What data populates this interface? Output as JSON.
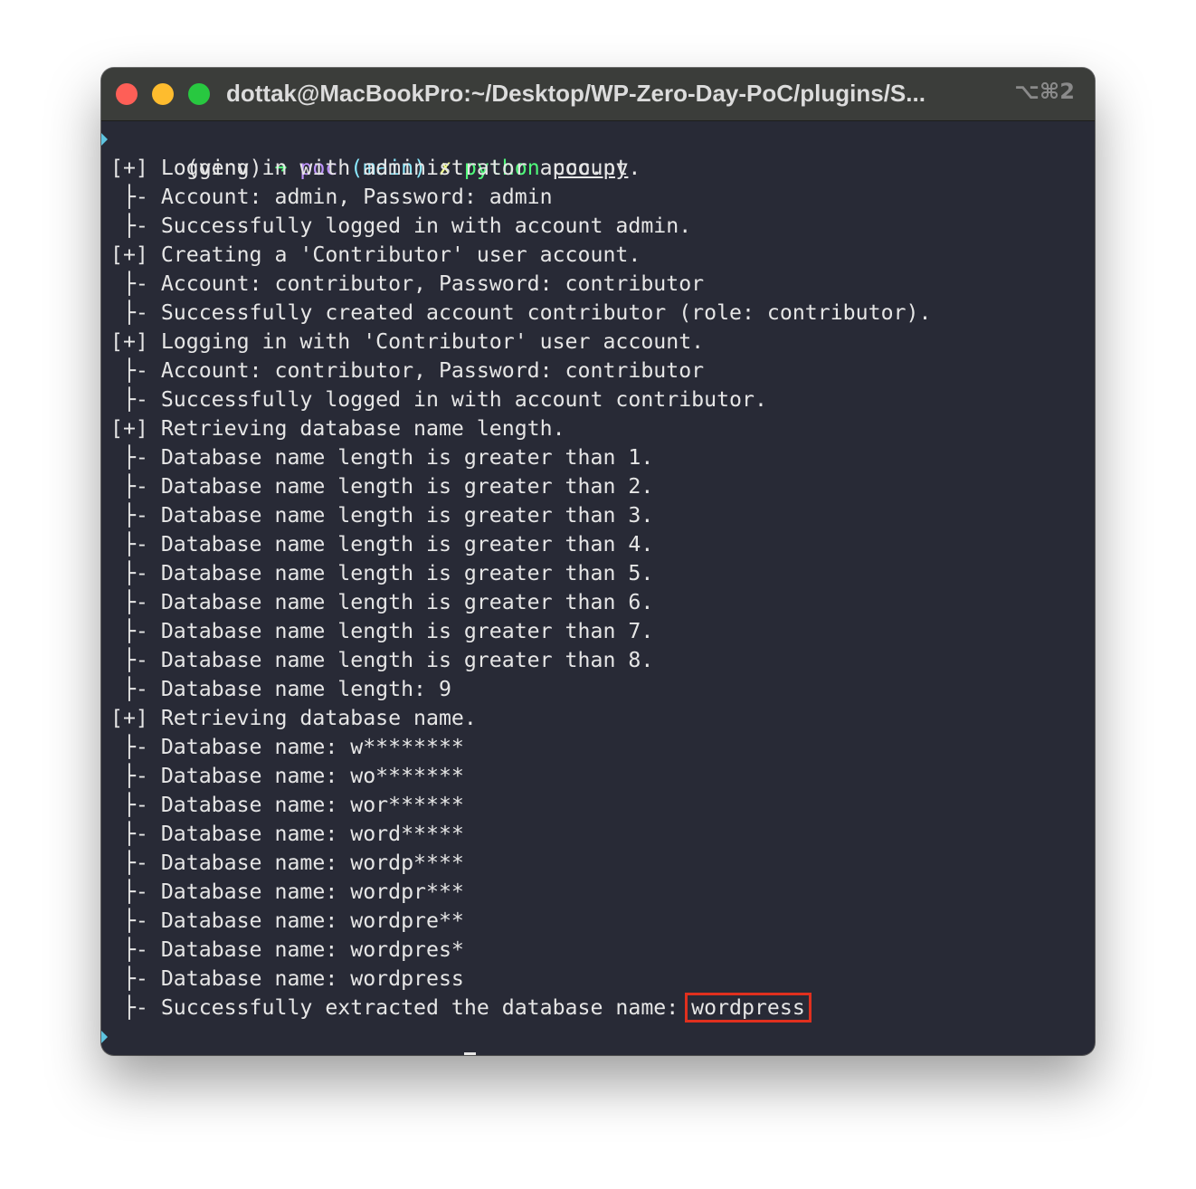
{
  "window": {
    "title": "dottak@MacBookPro:~/Desktop/WP-Zero-Day-PoC/plugins/S...",
    "shortcut": "⌥⌘2",
    "traffic_lights": {
      "close": "#fe5f57",
      "minimize": "#febc2e",
      "zoom": "#28c840"
    }
  },
  "colors": {
    "background": "#282a36",
    "foreground": "#e6e6e6",
    "prompt_arrow": "#50fa7b",
    "prompt_dir": "#bd93f9",
    "prompt_branch": "#8be9fd",
    "prompt_dirty": "#f1fa8c",
    "highlight_box": "#e0301e"
  },
  "prompt": {
    "venv": "(venv) ",
    "arrow": "➜ ",
    "dir": "poc ",
    "branch": "(main) ",
    "dirty": "✗ "
  },
  "command": {
    "program": "python",
    "argument": "poc.py"
  },
  "output": [
    "[+] Logging in with administrator account.",
    " ├- Account: admin, Password: admin",
    " ├- Successfully logged in with account admin.",
    "[+] Creating a 'Contributor' user account.",
    " ├- Account: contributor, Password: contributor",
    " ├- Successfully created account contributor (role: contributor).",
    "[+] Logging in with 'Contributor' user account.",
    " ├- Account: contributor, Password: contributor",
    " ├- Successfully logged in with account contributor.",
    "[+] Retrieving database name length.",
    " ├- Database name length is greater than 1.",
    " ├- Database name length is greater than 2.",
    " ├- Database name length is greater than 3.",
    " ├- Database name length is greater than 4.",
    " ├- Database name length is greater than 5.",
    " ├- Database name length is greater than 6.",
    " ├- Database name length is greater than 7.",
    " ├- Database name length is greater than 8.",
    " ├- Database name length: 9",
    "[+] Retrieving database name.",
    " ├- Database name: w********",
    " ├- Database name: wo*******",
    " ├- Database name: wor******",
    " ├- Database name: word*****",
    " ├- Database name: wordp****",
    " ├- Database name: wordpr***",
    " ├- Database name: wordpre**",
    " ├- Database name: wordpres*",
    " ├- Database name: wordpress"
  ],
  "final_line": {
    "prefix": " ├- Successfully extracted the database name: ",
    "highlighted": "wordpress"
  }
}
